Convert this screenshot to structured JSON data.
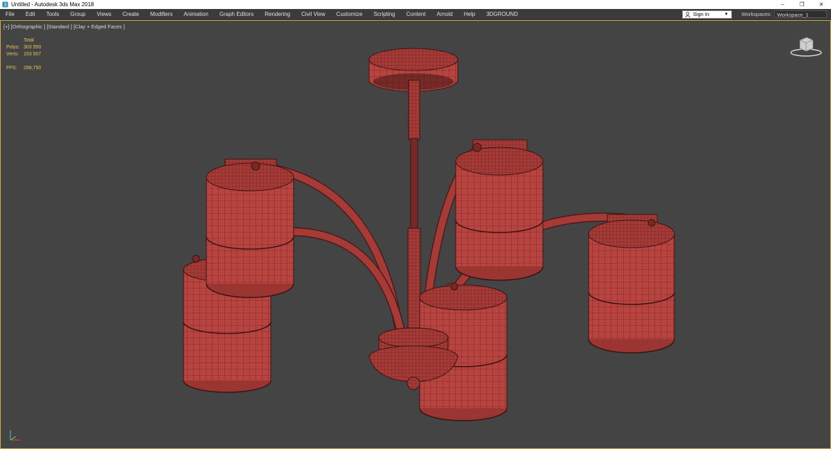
{
  "window": {
    "title": "Untitled - Autodesk 3ds Max 2018"
  },
  "window_controls": {
    "minimize": "–",
    "restore": "❐",
    "close": "✕"
  },
  "menu": [
    "File",
    "Edit",
    "Tools",
    "Group",
    "Views",
    "Create",
    "Modifiers",
    "Animation",
    "Graph Editors",
    "Rendering",
    "Civil View",
    "Customize",
    "Scripting",
    "Content",
    "Arnold",
    "Help",
    "3DGROUND"
  ],
  "signin": {
    "label": "Sign In",
    "caret": "▼"
  },
  "workspace": {
    "label": "Workspaces:",
    "value": "Workspace_1"
  },
  "viewport": {
    "label": "[+] [Orthographic ] [Standard ] [Clay + Edged Faces ]",
    "stats": {
      "header": "Total",
      "polys_label": "Polys:",
      "polys_value": "303 950",
      "verts_label": "Verts:",
      "verts_value": "153 507",
      "fps_label": "FPS:",
      "fps_value": "288,750"
    }
  },
  "colors": {
    "accent_border": "#d0b04a",
    "stat_text": "#e3c84e",
    "model_fill": "#b0403c",
    "model_wire": "#4a1a18",
    "viewport_bg": "#444444"
  }
}
